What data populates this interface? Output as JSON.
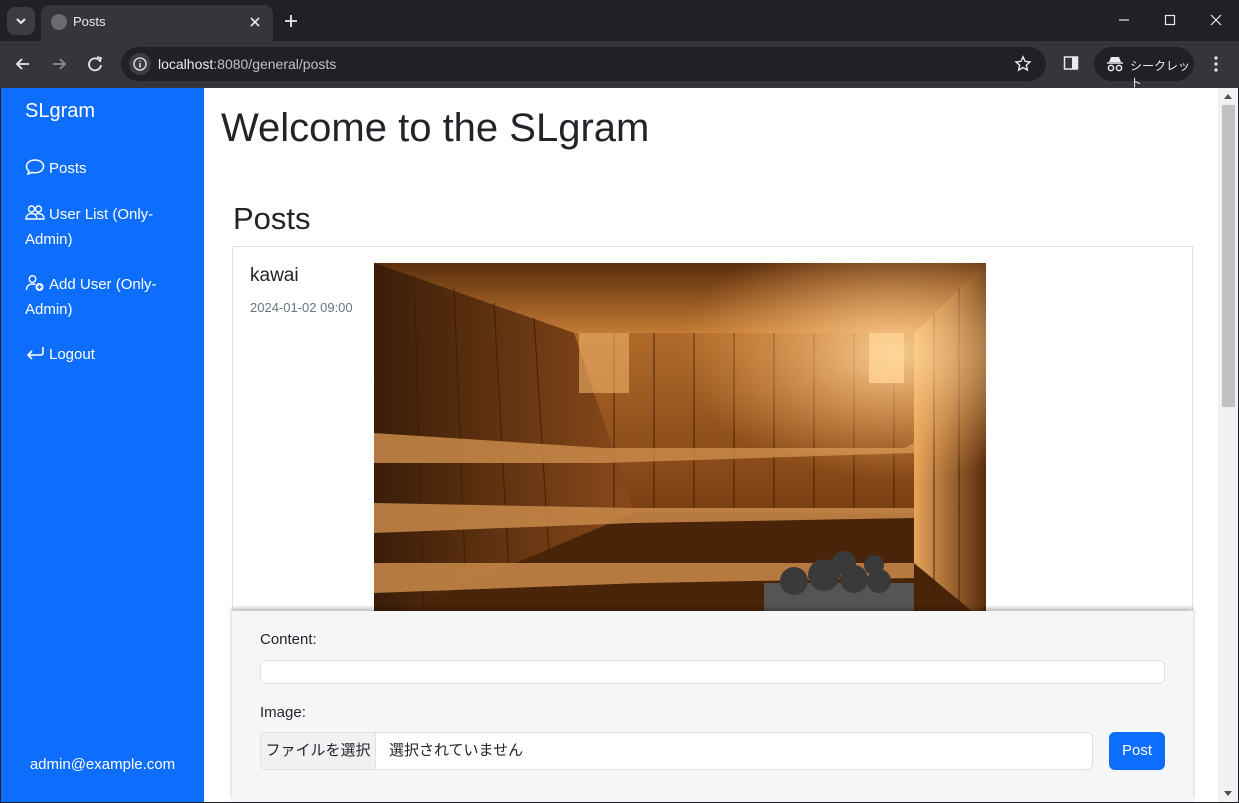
{
  "browser": {
    "tab_title": "Posts",
    "url_host": "localhost",
    "url_rest": ":8080/general/posts",
    "incognito_label": "シークレット"
  },
  "sidebar": {
    "brand": "SLgram",
    "items": [
      {
        "label": "Posts",
        "icon": "chat-icon"
      },
      {
        "label": "User List (Only-Admin)",
        "icon": "people-icon"
      },
      {
        "label": "Add User (Only-Admin)",
        "icon": "person-add-icon"
      },
      {
        "label": "Logout",
        "icon": "return-arrow-icon"
      }
    ],
    "user_email": "admin@example.com"
  },
  "main": {
    "page_title": "Welcome to the SLgram",
    "section_title": "Posts",
    "post": {
      "username": "kawai",
      "date": "2024-01-02 09:00",
      "image_subject": "sauna"
    },
    "form": {
      "content_label": "Content:",
      "content_value": "",
      "image_label": "Image:",
      "file_button": "ファイルを選択",
      "file_status": "選択されていません",
      "submit_label": "Post"
    }
  },
  "colors": {
    "primary": "#0d6efd",
    "chrome_dark": "#202124",
    "chrome_toolbar": "#35363a"
  }
}
